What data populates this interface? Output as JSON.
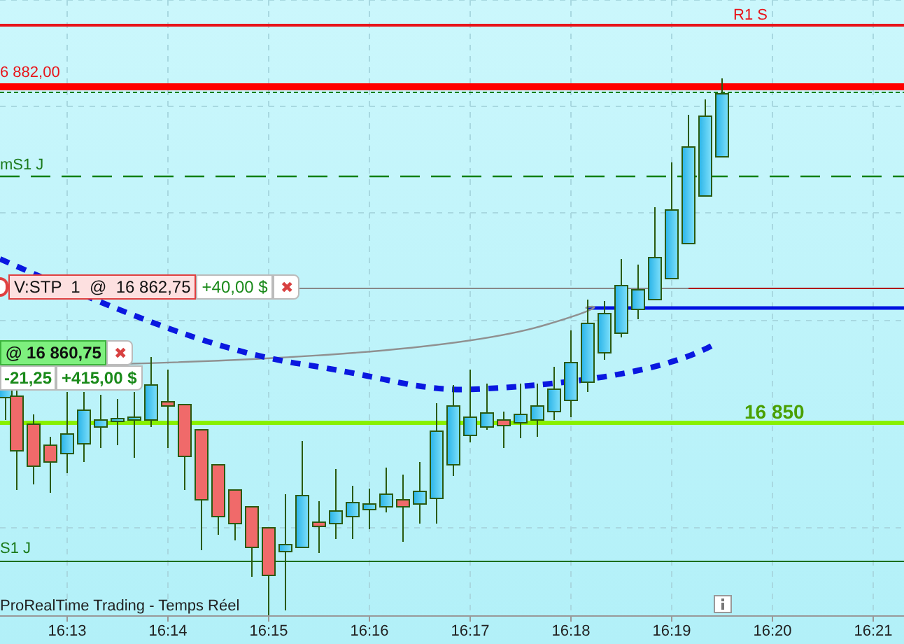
{
  "levels": [
    {
      "kind": "r1",
      "label": "R1 S"
    },
    {
      "kind": "target",
      "label": "6 882,00"
    },
    {
      "kind": "ms1",
      "label": "mS1 J"
    },
    {
      "kind": "alert",
      "label": "16 850"
    },
    {
      "kind": "s1",
      "label": "S1 J"
    }
  ],
  "orders": [
    {
      "kind": "stop",
      "text": "V:STP  1  @  16 862,75",
      "gain": "+40,00 $",
      "close": "✖"
    },
    {
      "kind": "position",
      "text": "@ 16 860,75",
      "points": "-21,25",
      "gain": "+415,00 $",
      "close": "✖"
    }
  ],
  "source": "ProRealTime Trading - Temps Réel",
  "x_axis": [
    "16:13",
    "16:14",
    "16:15",
    "16:16",
    "16:17",
    "16:18",
    "16:19",
    "16:20",
    "16:21"
  ]
}
